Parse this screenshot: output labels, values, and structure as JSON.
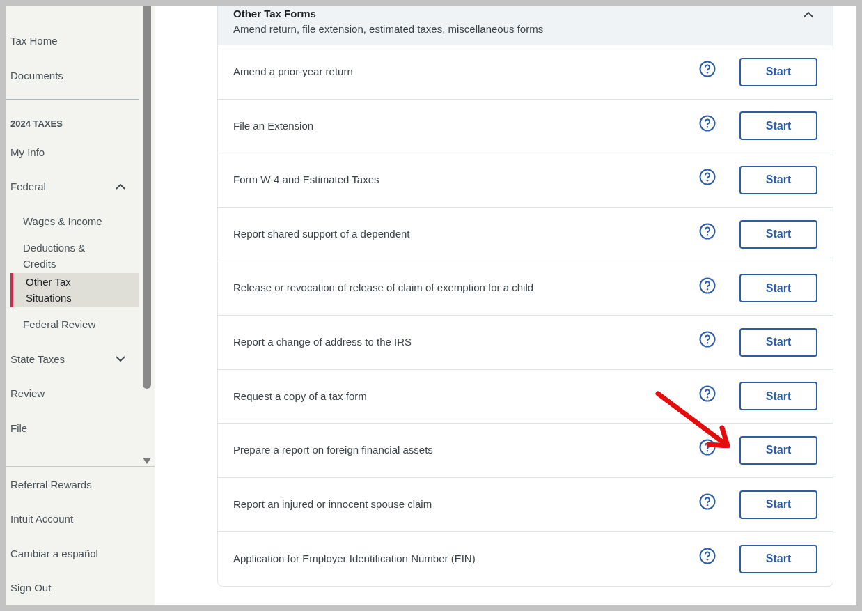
{
  "sidebar": {
    "top_items": [
      {
        "label": "Tax Home",
        "selected": false
      },
      {
        "label": "Documents",
        "selected": false
      }
    ],
    "section_label": "2024 TAXES",
    "nav_items": [
      {
        "label": "My Info",
        "selected": false
      },
      {
        "label": "Federal",
        "selected": false,
        "expanded": true,
        "children": [
          {
            "label": "Wages & Income",
            "selected": false
          },
          {
            "label": "Deductions & Credits",
            "selected": false
          },
          {
            "label": "Other Tax Situations",
            "selected": true
          },
          {
            "label": "Federal Review",
            "selected": false
          }
        ]
      },
      {
        "label": "State Taxes",
        "selected": false,
        "expanded": false
      },
      {
        "label": "Review",
        "selected": false
      },
      {
        "label": "File",
        "selected": false
      }
    ],
    "bottom_items": [
      {
        "label": "Referral Rewards"
      },
      {
        "label": "Intuit Account"
      },
      {
        "label": "Cambiar a español"
      },
      {
        "label": "Sign Out"
      }
    ]
  },
  "section": {
    "title": "Other Tax Forms",
    "subtitle": "Amend return, file extension, estimated taxes, miscellaneous forms",
    "expanded": true,
    "rows": [
      {
        "label": "Amend a prior-year return",
        "button": "Start"
      },
      {
        "label": "File an Extension",
        "button": "Start"
      },
      {
        "label": "Form W-4 and Estimated Taxes",
        "button": "Start"
      },
      {
        "label": "Report shared support of a dependent",
        "button": "Start"
      },
      {
        "label": "Release or revocation of release of claim of exemption for a child",
        "button": "Start"
      },
      {
        "label": "Report a change of address to the IRS",
        "button": "Start"
      },
      {
        "label": "Request a copy of a tax form",
        "button": "Start"
      },
      {
        "label": "Prepare a report on foreign financial assets",
        "button": "Start"
      },
      {
        "label": "Report an injured or innocent spouse claim",
        "button": "Start"
      },
      {
        "label": "Application for Employer Identification Number (EIN)",
        "button": "Start"
      }
    ]
  }
}
